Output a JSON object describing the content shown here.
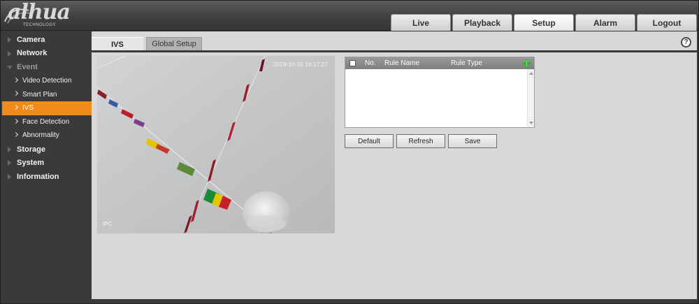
{
  "header": {
    "logo_text": "alhua",
    "logo_subtext": "TECHNOLOGY",
    "nav": [
      {
        "label": "Live",
        "active": false
      },
      {
        "label": "Playback",
        "active": false
      },
      {
        "label": "Setup",
        "active": true
      },
      {
        "label": "Alarm",
        "active": false
      },
      {
        "label": "Logout",
        "active": false
      }
    ]
  },
  "sidebar": {
    "items": [
      {
        "label": "Camera",
        "type": "section"
      },
      {
        "label": "Network",
        "type": "section"
      },
      {
        "label": "Event",
        "type": "section",
        "open": true
      },
      {
        "label": "Video Detection",
        "type": "sub"
      },
      {
        "label": "Smart Plan",
        "type": "sub"
      },
      {
        "label": "IVS",
        "type": "sub",
        "active": true
      },
      {
        "label": "Face Detection",
        "type": "sub"
      },
      {
        "label": "Abnormality",
        "type": "sub"
      },
      {
        "label": "Storage",
        "type": "section"
      },
      {
        "label": "System",
        "type": "section"
      },
      {
        "label": "Information",
        "type": "section"
      }
    ]
  },
  "main": {
    "tabs": [
      {
        "label": "IVS",
        "active": true
      },
      {
        "label": "Global Setup",
        "active": false
      }
    ],
    "help_icon": "?",
    "video": {
      "timestamp": "2018-10-20 16:17:27",
      "channel_name": "IPC"
    },
    "rule_table": {
      "columns": [
        "No.",
        "Rule Name",
        "Rule Type"
      ],
      "rows": []
    },
    "buttons": {
      "default": "Default",
      "refresh": "Refresh",
      "save": "Save"
    }
  },
  "colors": {
    "accent": "#f08a1a",
    "sidebar_bg": "#3a3a3a",
    "content_bg": "#d8d8d8",
    "add_icon": "#2fae2f"
  },
  "icons": {
    "help": "help-icon",
    "add_rule": "plus-icon",
    "menu_collapsed": "triangle-right-icon",
    "menu_expanded": "triangle-down-icon",
    "sub_item": "chevron-right-icon"
  }
}
